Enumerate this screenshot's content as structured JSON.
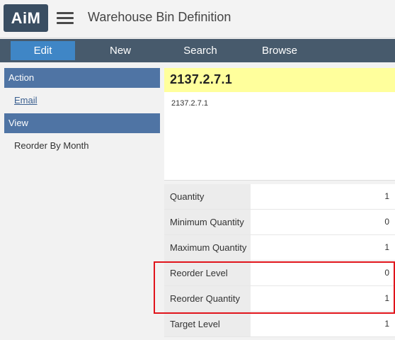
{
  "header": {
    "logo": "AiM",
    "title": "Warehouse Bin Definition"
  },
  "nav": {
    "edit": "Edit",
    "new": "New",
    "search": "Search",
    "browse": "Browse"
  },
  "sidebar": {
    "action_header": "Action",
    "email": "Email",
    "view_header": "View",
    "reorder_by_month": "Reorder By Month"
  },
  "record": {
    "id": "2137.2.7.1",
    "description": "2137.2.7.1"
  },
  "fields": [
    {
      "label": "Quantity",
      "value": "1"
    },
    {
      "label": "Minimum Quantity",
      "value": "0"
    },
    {
      "label": "Maximum Quantity",
      "value": "1"
    },
    {
      "label": "Reorder Level",
      "value": "0"
    },
    {
      "label": "Reorder Quantity",
      "value": "1"
    },
    {
      "label": "Target Level",
      "value": "1"
    }
  ],
  "colors": {
    "navbar": "#475a6c",
    "active_tab": "#3f86c6",
    "sidebar_header": "#4f74a4",
    "title_highlight": "#ffff9c",
    "annotation_box": "#e0141b"
  }
}
